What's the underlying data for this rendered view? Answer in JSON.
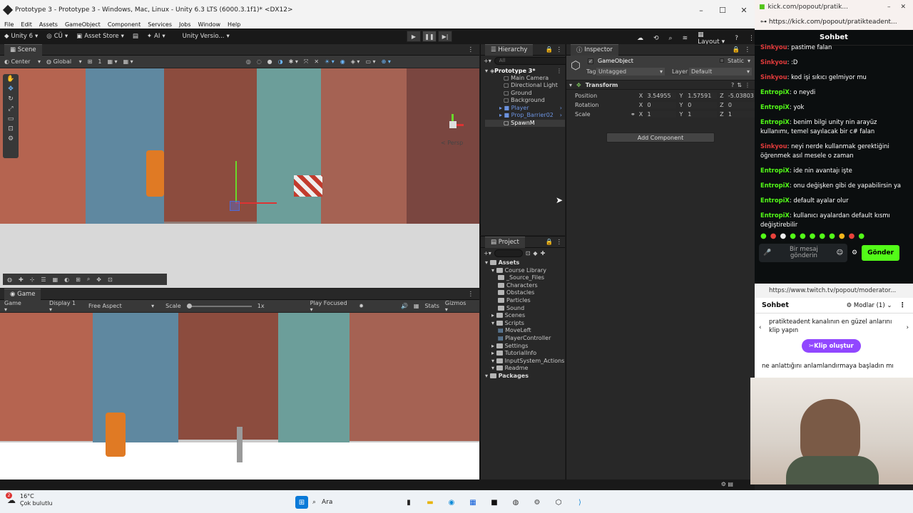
{
  "unity": {
    "title": "Prototype 3 - Prototype 3 - Windows, Mac, Linux - Unity 6.3 LTS (6000.3.1f1)* <DX12>",
    "menu": [
      "File",
      "Edit",
      "Assets",
      "GameObject",
      "Component",
      "Services",
      "Jobs",
      "Window",
      "Help"
    ],
    "toolbar": {
      "account": "Unity 6",
      "user": "CÜ",
      "asset_store": "Asset Store",
      "ai": "AI",
      "version": "Unity Versio...",
      "layout": "Layout"
    },
    "scene": {
      "tab": "Scene",
      "pivot": "Center",
      "space": "Global",
      "grid_value": "1",
      "persp": "< Persp"
    },
    "game": {
      "tab": "Game",
      "mode": "Game",
      "display": "Display 1",
      "aspect": "Free Aspect",
      "scale_label": "Scale",
      "scale_value": "1x",
      "play_focused": "Play Focused",
      "stats": "Stats",
      "gizmos": "Gizmos"
    },
    "hierarchy": {
      "tab": "Hierarchy",
      "search_placeholder": "All",
      "scene_name": "Prototype 3*",
      "items": [
        "Main Camera",
        "Directional Light",
        "Ground",
        "Background",
        "Player",
        "Prop_Barrier02",
        "SpawnM"
      ]
    },
    "inspector": {
      "tab": "Inspector",
      "object_name": "GameObject",
      "static_label": "Static",
      "tag_label": "Tag",
      "tag_value": "Untagged",
      "layer_label": "Layer",
      "layer_value": "Default",
      "component": "Transform",
      "position_label": "Position",
      "rotation_label": "Rotation",
      "scale_label": "Scale",
      "axis_x": "X",
      "axis_y": "Y",
      "axis_z": "Z",
      "position": [
        "3.54955",
        "1.57591",
        "-5.03803"
      ],
      "rotation": [
        "0",
        "0",
        "0"
      ],
      "scale": [
        "1",
        "1",
        "1"
      ],
      "add_component": "Add Component"
    },
    "project": {
      "tab": "Project",
      "tree": [
        {
          "label": "Assets",
          "depth": 0,
          "bold": true
        },
        {
          "label": "Course Library",
          "depth": 1
        },
        {
          "label": "_Source_Files",
          "depth": 2
        },
        {
          "label": "Characters",
          "depth": 2
        },
        {
          "label": "Obstacles",
          "depth": 2
        },
        {
          "label": "Particles",
          "depth": 2
        },
        {
          "label": "Sound",
          "depth": 2
        },
        {
          "label": "Scenes",
          "depth": 1
        },
        {
          "label": "Scripts",
          "depth": 1
        },
        {
          "label": "MoveLeft",
          "depth": 2
        },
        {
          "label": "PlayerController",
          "depth": 2
        },
        {
          "label": "Settings",
          "depth": 1
        },
        {
          "label": "TutorialInfo",
          "depth": 1
        },
        {
          "label": "InputSystem_Actions",
          "depth": 1
        },
        {
          "label": "Readme",
          "depth": 1
        },
        {
          "label": "Packages",
          "depth": 0,
          "bold": true
        }
      ]
    }
  },
  "kick": {
    "window_title": "kick.com/popout/pratik...",
    "url": "https://kick.com/popout/pratikteadent...",
    "header": "Sohbet",
    "messages": [
      {
        "user": "Sinkyou",
        "text": ": pastime falan",
        "color": "#e23b3b"
      },
      {
        "user": "Sinkyou",
        "text": ": :D",
        "color": "#e23b3b"
      },
      {
        "user": "Sinkyou",
        "text": ": kod işi sıkıcı gelmiyor mu",
        "color": "#e23b3b"
      },
      {
        "user": "EntropiX",
        "text": ": o neydi",
        "color": "#53fc18"
      },
      {
        "user": "EntropiX",
        "text": ": yok",
        "color": "#53fc18"
      },
      {
        "user": "EntropiX",
        "text": ": benim bilgi unity nin arayüz kullanımı, temel sayılacak bir c# falan",
        "color": "#53fc18"
      },
      {
        "user": "Sinkyou",
        "text": ": neyi nerde kullanmak gerektiğini öğrenmek asıl mesele o zaman",
        "color": "#e23b3b"
      },
      {
        "user": "EntropiX",
        "text": ": ide nin avantajı işte",
        "color": "#53fc18"
      },
      {
        "user": "EntropiX",
        "text": ": onu değişken gibi de yapabilirsin ya",
        "color": "#53fc18"
      },
      {
        "user": "EntropiX",
        "text": ": default ayalar olur",
        "color": "#53fc18"
      },
      {
        "user": "EntropiX",
        "text": ": kullanıcı ayalardan default kısmı değiştirebilir",
        "color": "#53fc18"
      }
    ],
    "input_placeholder": "Bir mesaj gönderin",
    "send": "Gönder"
  },
  "twitch": {
    "url": "https://www.twitch.tv/popout/moderator...",
    "header": "Sohbet",
    "mods": "Modlar (1)",
    "promo": "pratikteadent kanalının en güzel anlarını klip yapın",
    "clip_button": "Klip oluştur",
    "partial_msg": "ne anlattığını anlamlandırmaya başladın mı"
  },
  "taskbar": {
    "temperature": "16°C",
    "weather": "Çok bulutlu",
    "search": "Ara",
    "badge": "2"
  }
}
